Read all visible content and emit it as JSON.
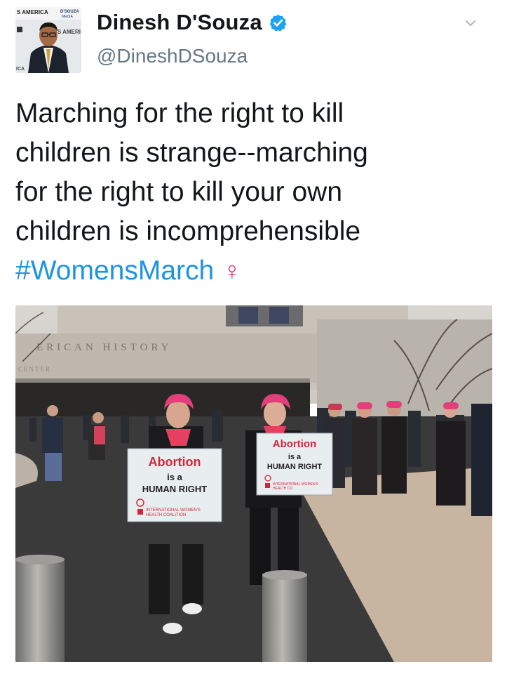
{
  "author": {
    "name": "Dinesh D'Souza",
    "handle": "@DineshDSouza",
    "verified": true
  },
  "avatar": {
    "banner_left": "S AMERICA",
    "banner_right_top": "D'SOUZA",
    "banner_right_bottom": "MEDIA",
    "backdrop_text": "'S AMERI",
    "corner_text": "ICA"
  },
  "tweet": {
    "lines": [
      "Marching for the right to kill",
      "children is strange--marching",
      "for the right to kill your own",
      "children is incomprehensible"
    ],
    "hashtag": "#WomensMarch",
    "emoji": "♀"
  },
  "photo": {
    "building_text": "ERICAN HISTORY",
    "building_subtext": "CENTER",
    "sign_left": {
      "line1": "Abortion",
      "line2": "is a",
      "line3": "HUMAN RIGHT",
      "footer1": "INTERNATIONAL WOMEN'S",
      "footer2": "HEALTH COALITION"
    },
    "sign_right": {
      "line1": "Abortion",
      "line2": "is a",
      "line3": "HUMAN RIGHT",
      "footer1": "INTERNATIONAL WOMEN'S",
      "footer2": "HEALTH CO"
    }
  },
  "colors": {
    "link": "#1b95e0",
    "verified": "#1da1f2",
    "handle": "#657786",
    "sign_red": "#d0283a",
    "hat_pink": "#e2407a"
  },
  "icons": {
    "verified": "verified-badge-icon",
    "caret": "chevron-down-icon"
  }
}
